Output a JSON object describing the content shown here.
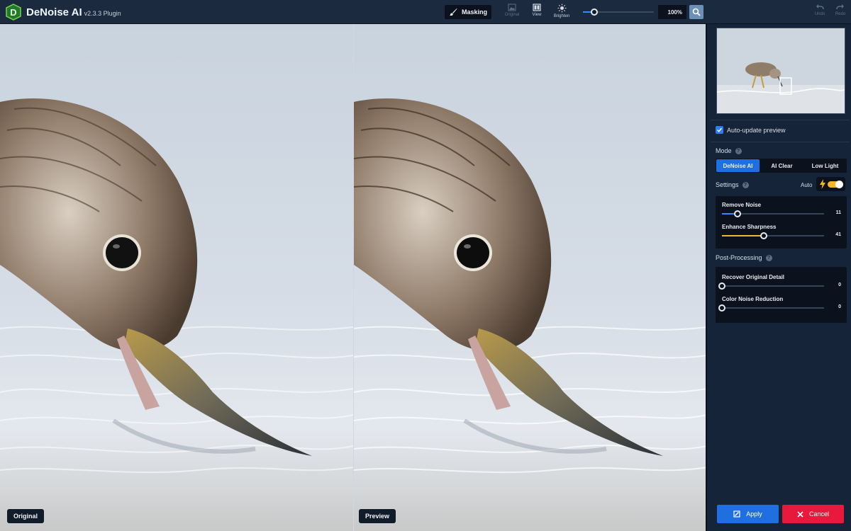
{
  "app": {
    "name": "DeNoise AI",
    "version": "v2.3.3 Plugin",
    "logo_letter": "D"
  },
  "toolbar": {
    "masking_label": "Masking",
    "original_label": "Original",
    "view_label": "View",
    "brighten_label": "Brighten",
    "zoom_fraction": 0.16,
    "zoom_value": "100%",
    "undo_label": "Undo",
    "redo_label": "Redo"
  },
  "panes": {
    "left_label": "Original",
    "right_label": "Preview"
  },
  "panel": {
    "auto_update_label": "Auto-update preview",
    "auto_update_checked": true,
    "mode_label": "Mode",
    "modes": [
      {
        "label": "DeNoise AI",
        "active": true
      },
      {
        "label": "AI Clear",
        "active": false
      },
      {
        "label": "Low Light",
        "active": false
      }
    ],
    "settings_label": "Settings",
    "auto_label": "Auto",
    "auto_on": true,
    "settings_sliders": [
      {
        "label": "Remove Noise",
        "value": "11",
        "fraction": 0.15
      },
      {
        "label": "Enhance Sharpness",
        "value": "41",
        "fraction": 0.41
      }
    ],
    "post_processing_label": "Post-Processing",
    "post_sliders": [
      {
        "label": "Recover Original Detail",
        "value": "0",
        "fraction": 0
      },
      {
        "label": "Color Noise Reduction",
        "value": "0",
        "fraction": 0
      }
    ],
    "apply_label": "Apply",
    "cancel_label": "Cancel"
  },
  "colors": {
    "accent_blue": "#1f6fe0",
    "cancel_red": "#e8193c",
    "toggle_yellow": "#f2b82a",
    "sharpness_fill": "#f2b82a",
    "noise_fill": "#3f86f5"
  }
}
